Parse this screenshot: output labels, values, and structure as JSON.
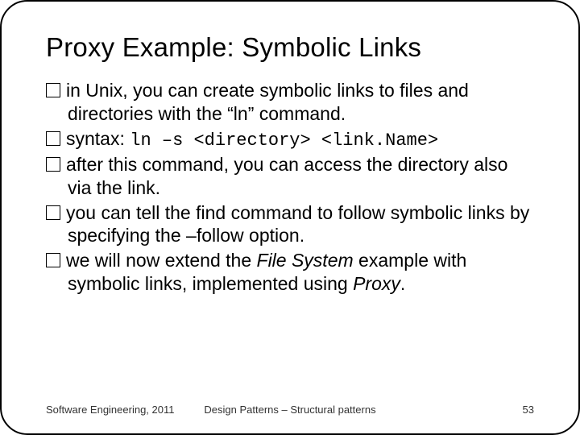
{
  "title": "Proxy Example: Symbolic Links",
  "bullets": {
    "b1a": "in Unix, you can create symbolic links to files and directories with the “ln” command.",
    "b2_label": "syntax: ",
    "b2_code": "ln –s <directory> <link.Name>",
    "b3": "after this command, you can access the directory also via the link.",
    "b4a": "you can tell the ",
    "b4_find": "find",
    "b4b": " command to follow symbolic links by specifying the ",
    "b4_follow": "–follow",
    "b4c": " option.",
    "b5a": "we will now extend the ",
    "b5_fs": "File System",
    "b5b": " example with symbolic links, implemented using ",
    "b5_proxy": "Proxy",
    "b5c": "."
  },
  "footer": {
    "left": "Software Engineering, 2011",
    "center": "Design Patterns – Structural patterns",
    "right": "53"
  }
}
